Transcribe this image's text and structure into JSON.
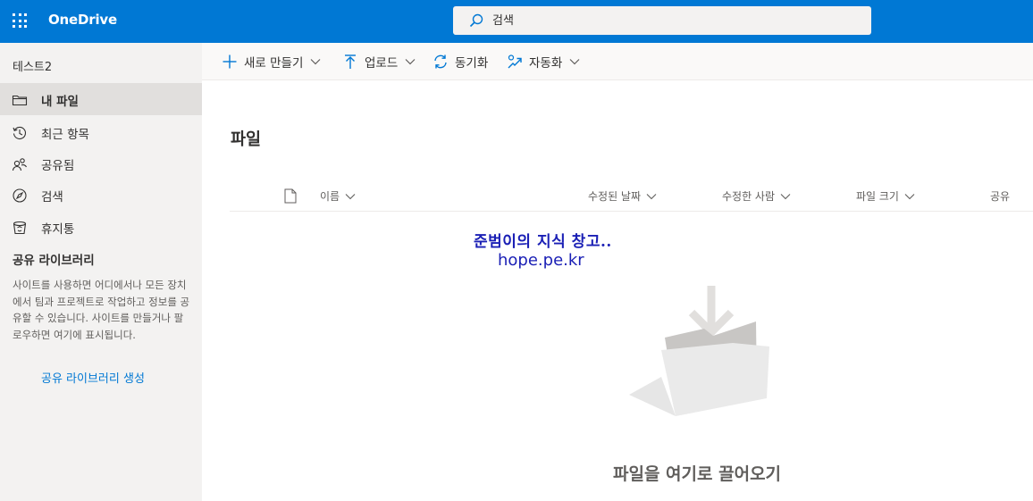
{
  "header": {
    "app_name": "OneDrive",
    "search_placeholder": "검색"
  },
  "sidebar": {
    "user": "테스트2",
    "items": [
      {
        "label": "내 파일",
        "icon": "folder-icon",
        "active": true
      },
      {
        "label": "최근 항목",
        "icon": "history-icon"
      },
      {
        "label": "공유됨",
        "icon": "people-icon"
      },
      {
        "label": "검색",
        "icon": "discover-icon"
      },
      {
        "label": "휴지통",
        "icon": "recycle-bin-icon"
      }
    ],
    "shared_libraries_title": "공유 라이브러리",
    "shared_libraries_desc": "사이트를 사용하면 어디에서나 모든 장치에서 팀과 프로젝트로 작업하고 정보를 공유할 수 있습니다. 사이트를 만들거나 팔로우하면 여기에 표시됩니다.",
    "create_library_link": "공유 라이브러리 생성"
  },
  "commands": {
    "new": "새로 만들기",
    "upload": "업로드",
    "sync": "동기화",
    "automate": "자동화"
  },
  "main": {
    "title": "파일",
    "columns": {
      "name": "이름",
      "modified": "수정된 날짜",
      "modified_by": "수정한 사람",
      "size": "파일 크기",
      "sharing": "공유"
    },
    "empty_message": "파일을 여기로 끌어오기"
  },
  "watermark": {
    "line1": "준범이의 지식 창고..",
    "line2": "hope.pe.kr"
  },
  "colors": {
    "brand": "#0078d4",
    "sidebar_bg": "#f3f2f1",
    "active_item_bg": "#e1dfdd"
  }
}
